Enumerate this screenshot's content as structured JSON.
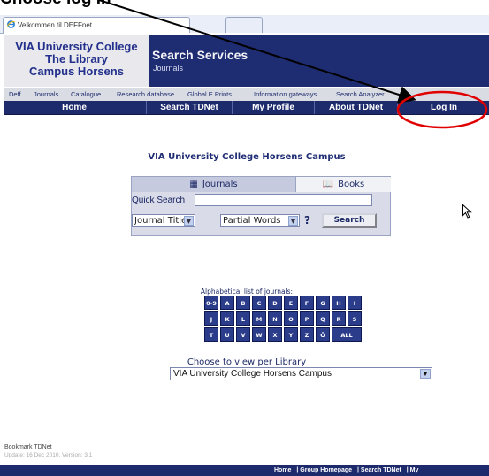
{
  "caption": "Choose log in",
  "browser": {
    "tab_title": "Velkommen til DEFFnet"
  },
  "logo": {
    "line1": "VIA University College",
    "line2": "The Library",
    "line3": "Campus Horsens"
  },
  "service": {
    "title": "Search Services",
    "subtitle": "Journals"
  },
  "subnav": [
    "Deff",
    "Journals",
    "Catalogue",
    "Research database",
    "Global E Prints",
    "Information gateways",
    "Search Analyzer"
  ],
  "mainnav": [
    "Home",
    "Search TDNet",
    "My Profile",
    "About TDNet",
    "Log In"
  ],
  "campus_title": "VIA University College Horsens Campus",
  "search": {
    "tab_journals": "Journals",
    "tab_books": "Books",
    "quick_search_label": "Quick Search",
    "quick_search_value": "",
    "field_select": "Journal Title",
    "match_select": "Partial Words",
    "help": "?",
    "button": "Search"
  },
  "alphabet": {
    "label": "Alphabetical list of journals:",
    "row1": [
      "0-9",
      "A",
      "B",
      "C",
      "D",
      "E",
      "F",
      "G",
      "H",
      "I"
    ],
    "row2": [
      "J",
      "K",
      "L",
      "M",
      "N",
      "O",
      "P",
      "Q",
      "R",
      "S"
    ],
    "row3": [
      "T",
      "U",
      "V",
      "W",
      "X",
      "Y",
      "Z",
      "Ö",
      "ALL"
    ]
  },
  "library": {
    "label": "Choose to view per Library",
    "selected": "VIA University College Horsens Campus"
  },
  "bookmark": "Bookmark TDNet",
  "update": "Update: 16 Dec 2010, Version: 3.1",
  "footer": [
    "Home",
    "| Group Homepage",
    "| Search TDNet",
    "| My"
  ],
  "colors": {
    "navy": "#1d2a6c",
    "annotation_red": "#e00000"
  }
}
